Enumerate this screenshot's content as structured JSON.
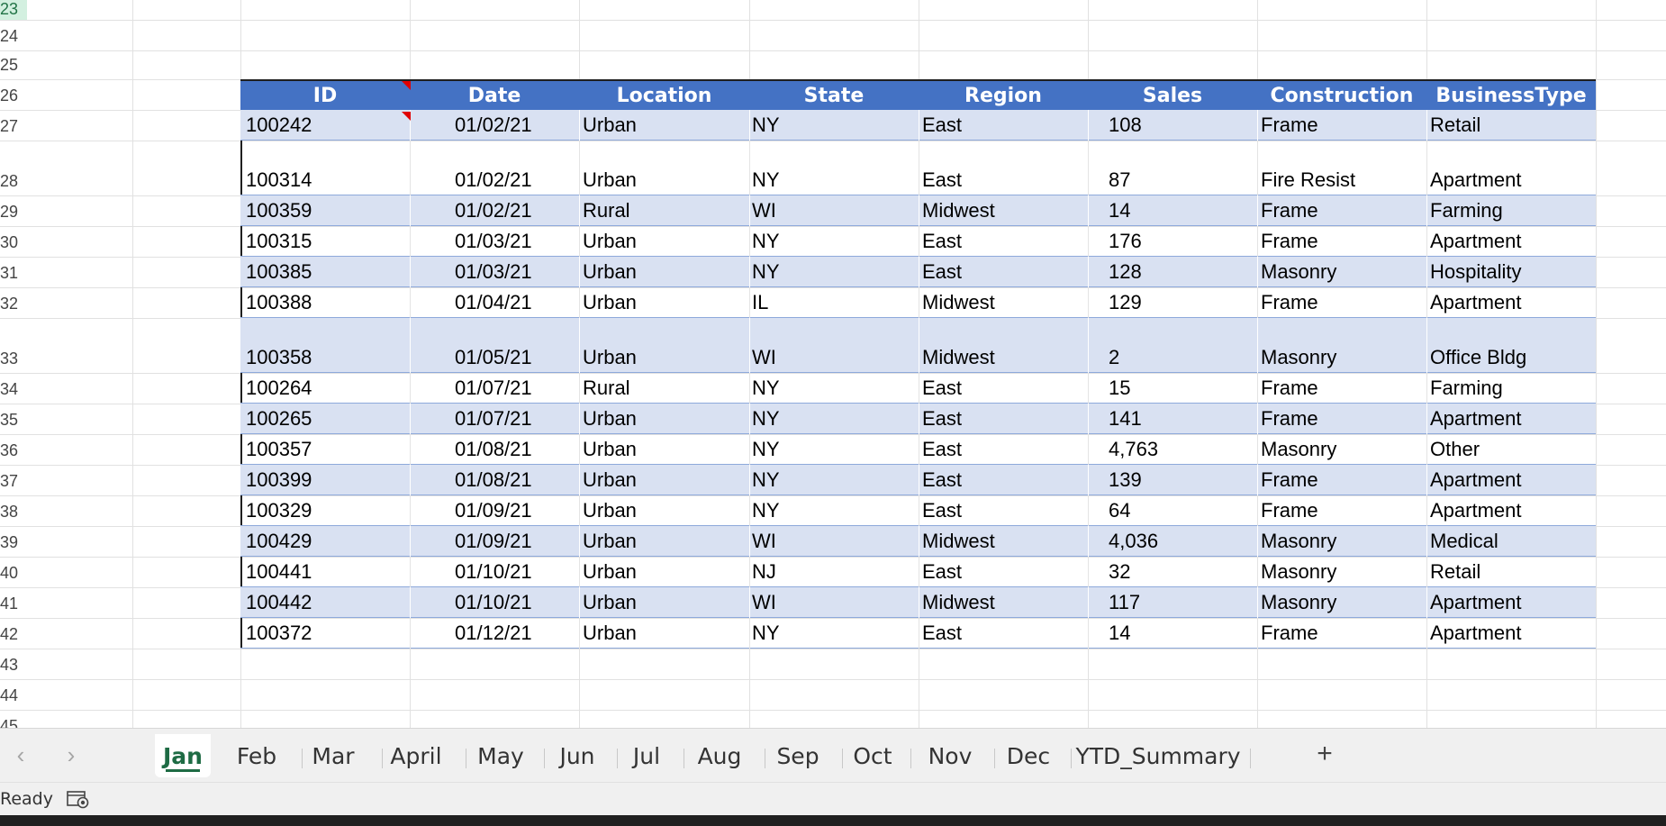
{
  "rows": {
    "numbers": [
      "23",
      "24",
      "25",
      "26",
      "27",
      "28",
      "29",
      "30",
      "31",
      "32",
      "33",
      "34",
      "35",
      "36",
      "37",
      "38",
      "39",
      "40",
      "41",
      "42",
      "43",
      "44",
      "45"
    ],
    "selected": "23"
  },
  "table": {
    "headers": [
      "ID",
      "Date",
      "Location",
      "State",
      "Region",
      "Sales",
      "Construction",
      "BusinessType"
    ],
    "rows": [
      [
        "100242",
        "01/02/21",
        "Urban",
        "NY",
        "East",
        "108",
        "Frame",
        "Retail"
      ],
      [
        "100314",
        "01/02/21",
        "Urban",
        "NY",
        "East",
        "87",
        "Fire Resist",
        "Apartment"
      ],
      [
        "100359",
        "01/02/21",
        "Rural",
        "WI",
        "Midwest",
        "14",
        "Frame",
        "Farming"
      ],
      [
        "100315",
        "01/03/21",
        "Urban",
        "NY",
        "East",
        "176",
        "Frame",
        "Apartment"
      ],
      [
        "100385",
        "01/03/21",
        "Urban",
        "NY",
        "East",
        "128",
        "Masonry",
        "Hospitality"
      ],
      [
        "100388",
        "01/04/21",
        "Urban",
        "IL",
        "Midwest",
        "129",
        "Frame",
        "Apartment"
      ],
      [
        "100358",
        "01/05/21",
        "Urban",
        "WI",
        "Midwest",
        "2",
        "Masonry",
        "Office Bldg"
      ],
      [
        "100264",
        "01/07/21",
        "Rural",
        "NY",
        "East",
        "15",
        "Frame",
        "Farming"
      ],
      [
        "100265",
        "01/07/21",
        "Urban",
        "NY",
        "East",
        "141",
        "Frame",
        "Apartment"
      ],
      [
        "100357",
        "01/08/21",
        "Urban",
        "NY",
        "East",
        "4,763",
        "Masonry",
        "Other"
      ],
      [
        "100399",
        "01/08/21",
        "Urban",
        "NY",
        "East",
        "139",
        "Frame",
        "Apartment"
      ],
      [
        "100329",
        "01/09/21",
        "Urban",
        "NY",
        "East",
        "64",
        "Frame",
        "Apartment"
      ],
      [
        "100429",
        "01/09/21",
        "Urban",
        "WI",
        "Midwest",
        "4,036",
        "Masonry",
        "Medical"
      ],
      [
        "100441",
        "01/10/21",
        "Urban",
        "NJ",
        "East",
        "32",
        "Masonry",
        "Retail"
      ],
      [
        "100442",
        "01/10/21",
        "Urban",
        "WI",
        "Midwest",
        "117",
        "Masonry",
        "Apartment"
      ],
      [
        "100372",
        "01/12/21",
        "Urban",
        "NY",
        "East",
        "14",
        "Frame",
        "Apartment"
      ]
    ]
  },
  "sheet_tabs": {
    "tabs": [
      "Jan",
      "Feb",
      "Mar",
      "April",
      "May",
      "Jun",
      "Jul",
      "Aug",
      "Sep",
      "Oct",
      "Nov",
      "Dec",
      "YTD_Summary"
    ],
    "active": "Jan",
    "prev_icon": "chevron-left-icon",
    "next_icon": "chevron-right-icon",
    "add_label": "+"
  },
  "status": {
    "text": "Ready",
    "macro_icon": "macro-recording-icon"
  },
  "colors": {
    "header_bg": "#4472c4",
    "band_bg": "#d9e1f2",
    "active_tab": "#1e6b44"
  }
}
